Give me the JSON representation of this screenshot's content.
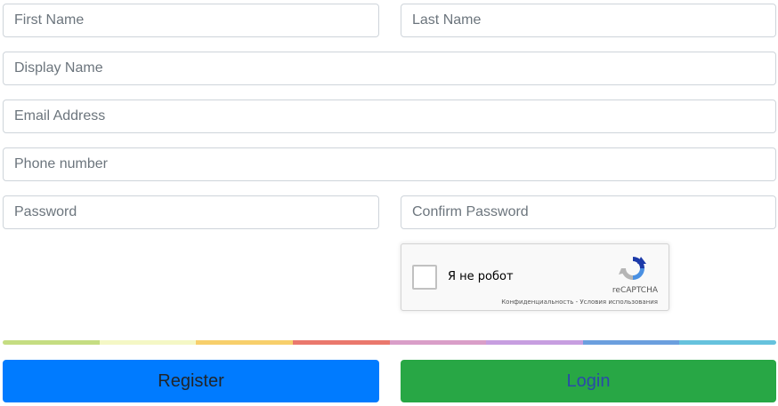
{
  "form": {
    "first_name": {
      "placeholder": "First Name",
      "value": ""
    },
    "last_name": {
      "placeholder": "Last Name",
      "value": ""
    },
    "display_name": {
      "placeholder": "Display Name",
      "value": ""
    },
    "email": {
      "placeholder": "Email Address",
      "value": ""
    },
    "phone": {
      "placeholder": "Phone number",
      "value": ""
    },
    "password": {
      "placeholder": "Password",
      "value": ""
    },
    "confirm_password": {
      "placeholder": "Confirm Password",
      "value": ""
    }
  },
  "recaptcha": {
    "label": "Я не робот",
    "brand": "reCAPTCHA",
    "privacy_link": "Конфиденциальность",
    "separator": " - ",
    "terms_link": "Условия использования",
    "logo_icon": "recaptcha-logo-icon",
    "checked": false
  },
  "color_bar": {
    "segments": [
      "#c5dd82",
      "#f4f7c5",
      "#f7cf6b",
      "#ea786d",
      "#d99ec8",
      "#c79ee0",
      "#6b9fde",
      "#66c2dd"
    ]
  },
  "buttons": {
    "register_label": "Register",
    "login_label": "Login",
    "register_color": "#007bff",
    "login_color": "#28a745"
  }
}
